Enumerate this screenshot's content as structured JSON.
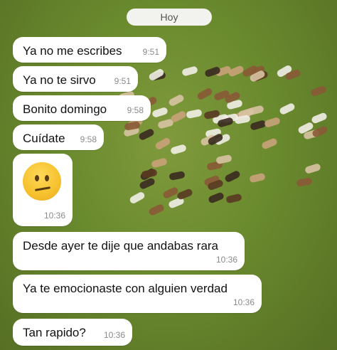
{
  "date_chip": "Hoy",
  "messages": [
    {
      "text": "Ya no me escribes",
      "time": "9:51"
    },
    {
      "text": "Ya no te sirvo",
      "time": "9:51"
    },
    {
      "text": "Bonito domingo",
      "time": "9:58"
    },
    {
      "text": "Cuídate",
      "time": "9:58"
    },
    {
      "emoji": "confused-face",
      "time": "10:36"
    },
    {
      "text": "Desde ayer te dije que andabas rara",
      "time": "10:36"
    },
    {
      "text": "Ya te emocionaste con alguien verdad",
      "time": "10:36"
    },
    {
      "text": "Tan rapido?",
      "time": "10:36"
    }
  ],
  "colors": {
    "bubble": "#ffffff",
    "chip": "#f2f2ee",
    "grass": "#6a8a2e"
  }
}
